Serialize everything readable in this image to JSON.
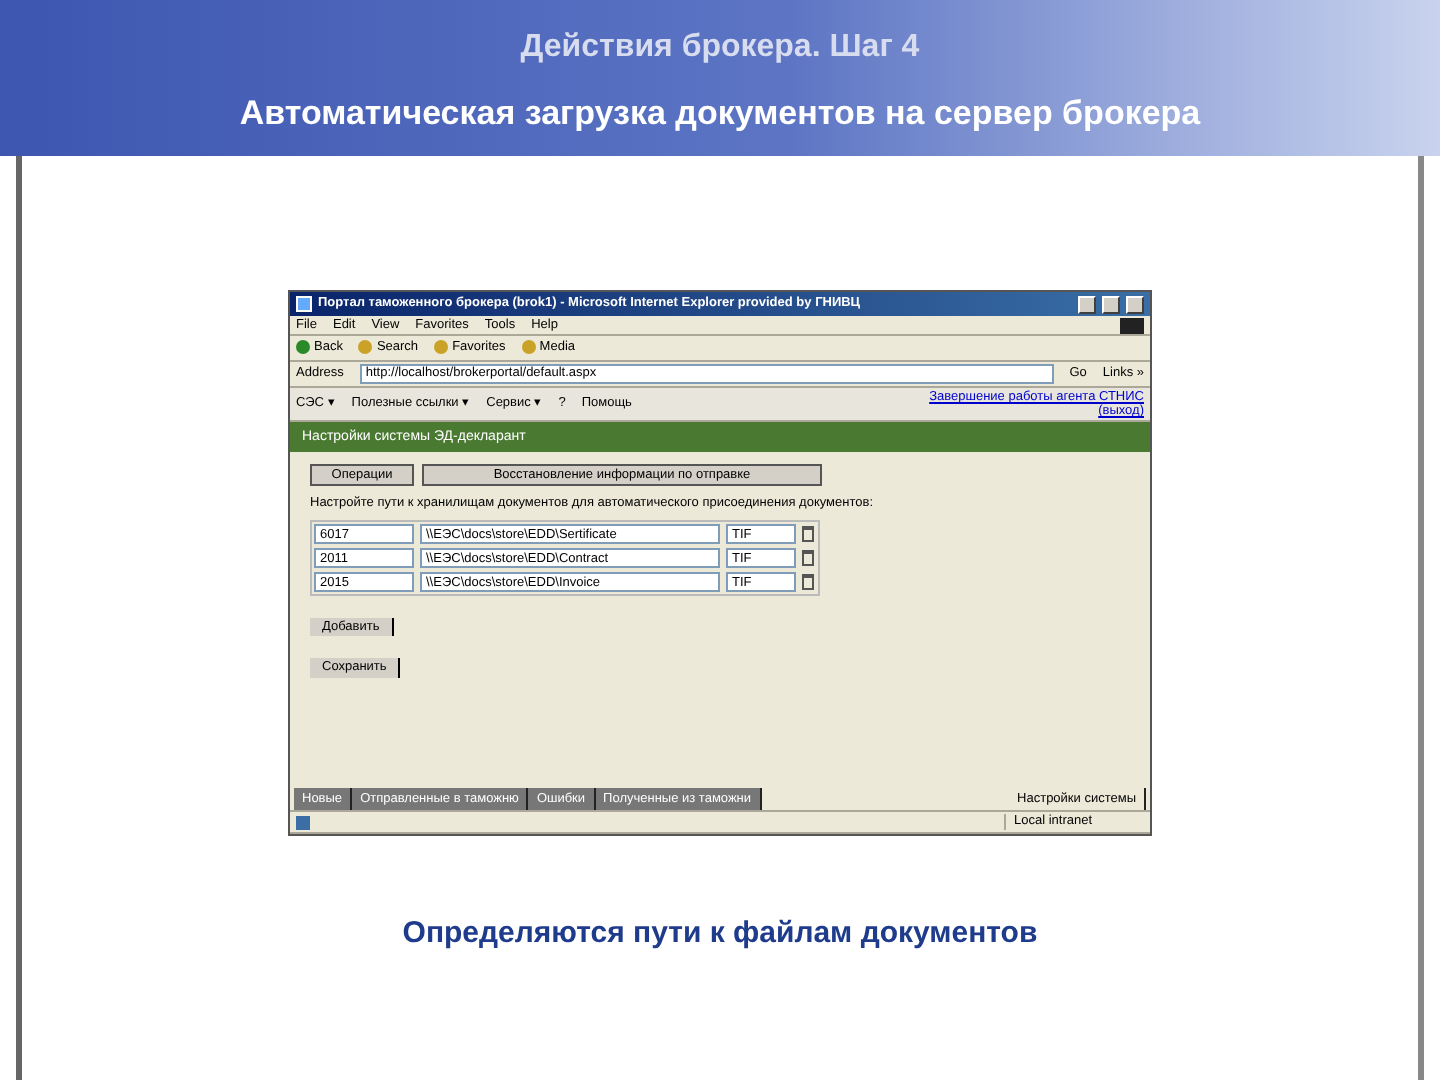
{
  "slide": {
    "title": "Действия брокера.  Шаг 4",
    "subtitle": "Автоматическая загрузка документов на сервер брокера",
    "caption": "Определяются пути к файлам документов"
  },
  "browser": {
    "title": "Портал таможенного брокера (brok1) - Microsoft Internet Explorer provided by ГНИВЦ",
    "menu": [
      "File",
      "Edit",
      "View",
      "Favorites",
      "Tools",
      "Help"
    ],
    "toolbar": [
      "Back",
      "Search",
      "Favorites",
      "Media"
    ],
    "address_label": "Address",
    "url": "http://localhost/brokerportal/default.aspx",
    "go": "Go",
    "links": "Links »",
    "app_menu": [
      "СЭС ▾",
      "Полезные ссылки ▾",
      "Сервис ▾",
      "?",
      "Помощь"
    ],
    "logout": "Завершение работы агента СТНИС",
    "logout_2": "(выход)",
    "section_title": "Настройки системы ЭД-декларант",
    "top_buttons": [
      "Операции",
      "Восстановление информации по отправке"
    ],
    "instruction": "Настройте пути к хранилищам документов для автоматического присоединения документов:",
    "rows": [
      {
        "code": "6017",
        "path": "\\\\ЕЭС\\docs\\store\\EDD\\Sertificate",
        "ext": "TIF"
      },
      {
        "code": "2011",
        "path": "\\\\ЕЭС\\docs\\store\\EDD\\Contract",
        "ext": "TIF"
      },
      {
        "code": "2015",
        "path": "\\\\ЕЭС\\docs\\store\\EDD\\Invoice",
        "ext": "TIF"
      }
    ],
    "buttons": [
      "Добавить",
      "Сохранить"
    ],
    "tabs": [
      {
        "label": "Новые",
        "selected": false
      },
      {
        "label": "Отправленные в таможню",
        "selected": false
      },
      {
        "label": "Ошибки",
        "selected": false
      },
      {
        "label": "Полученные из таможни",
        "selected": false
      },
      {
        "label": "Настройки системы",
        "selected": true
      }
    ],
    "status_zone": "Local intranet"
  }
}
